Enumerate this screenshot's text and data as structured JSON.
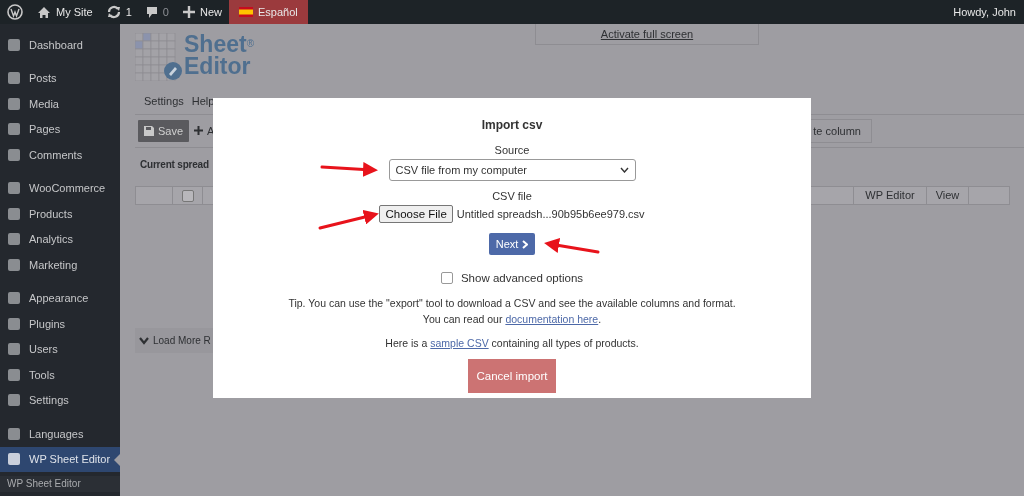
{
  "admin_bar": {
    "items": [
      {
        "kind": "wp-logo",
        "selected": false
      },
      {
        "kind": "home",
        "label": "My Site",
        "selected": false
      },
      {
        "kind": "updates",
        "label": "1",
        "selected": false
      },
      {
        "kind": "comments",
        "label": "0",
        "selected": false
      },
      {
        "kind": "new",
        "label": "New",
        "selected": false
      },
      {
        "kind": "language",
        "label": "Español",
        "selected": true
      }
    ],
    "greeting": "Howdy, John"
  },
  "sidebar": {
    "groups": [
      {
        "items": [
          {
            "label": "Dashboard",
            "selected": false
          }
        ]
      },
      {
        "items": [
          {
            "label": "Posts",
            "selected": false
          },
          {
            "label": "Media",
            "selected": false
          },
          {
            "label": "Pages",
            "selected": false
          },
          {
            "label": "Comments",
            "selected": false
          }
        ]
      },
      {
        "items": [
          {
            "label": "WooCommerce",
            "selected": false
          },
          {
            "label": "Products",
            "selected": false
          },
          {
            "label": "Analytics",
            "selected": false
          },
          {
            "label": "Marketing",
            "selected": false
          }
        ]
      },
      {
        "items": [
          {
            "label": "Appearance",
            "selected": false
          },
          {
            "label": "Plugins",
            "selected": false
          },
          {
            "label": "Users",
            "selected": false
          },
          {
            "label": "Tools",
            "selected": false
          },
          {
            "label": "Settings",
            "selected": false
          }
        ]
      },
      {
        "items": [
          {
            "label": "Languages",
            "selected": false
          },
          {
            "label": "WP Sheet Editor",
            "selected": true
          }
        ]
      }
    ],
    "submenu": [
      "WP Sheet Editor"
    ]
  },
  "page": {
    "logo": {
      "line_1": "Sheet",
      "mark": "®",
      "line_2": "Editor"
    },
    "fullscreen_link": "Activate full screen",
    "menu": [
      "Settings",
      "Help"
    ],
    "save_button": "Save",
    "add_button": "A",
    "column_button": "te column",
    "caption": "Current spread",
    "table": {
      "header_checkbox": {
        "checked": false
      },
      "columns": [
        "WP Editor",
        "View"
      ]
    },
    "load_more": "Load More R"
  },
  "modal": {
    "title": "Import csv",
    "source_label": "Source",
    "source_value": "CSV file from my computer",
    "file_label": "CSV file",
    "file_button": "Choose File",
    "file_name": "Untitled spreadsh...90b95b6ee979.csv",
    "next_button": "Next",
    "advanced": {
      "label": "Show advanced options",
      "checked": false
    },
    "tip": "Tip. You can use the \"export\" tool to download a CSV and see the available columns and format.",
    "docs": {
      "before": "You can read our ",
      "link": "documentation here",
      "after": "."
    },
    "sample": {
      "before": "Here is a ",
      "link": "sample CSV",
      "after": " containing all types of products."
    },
    "cancel_button": "Cancel import"
  }
}
